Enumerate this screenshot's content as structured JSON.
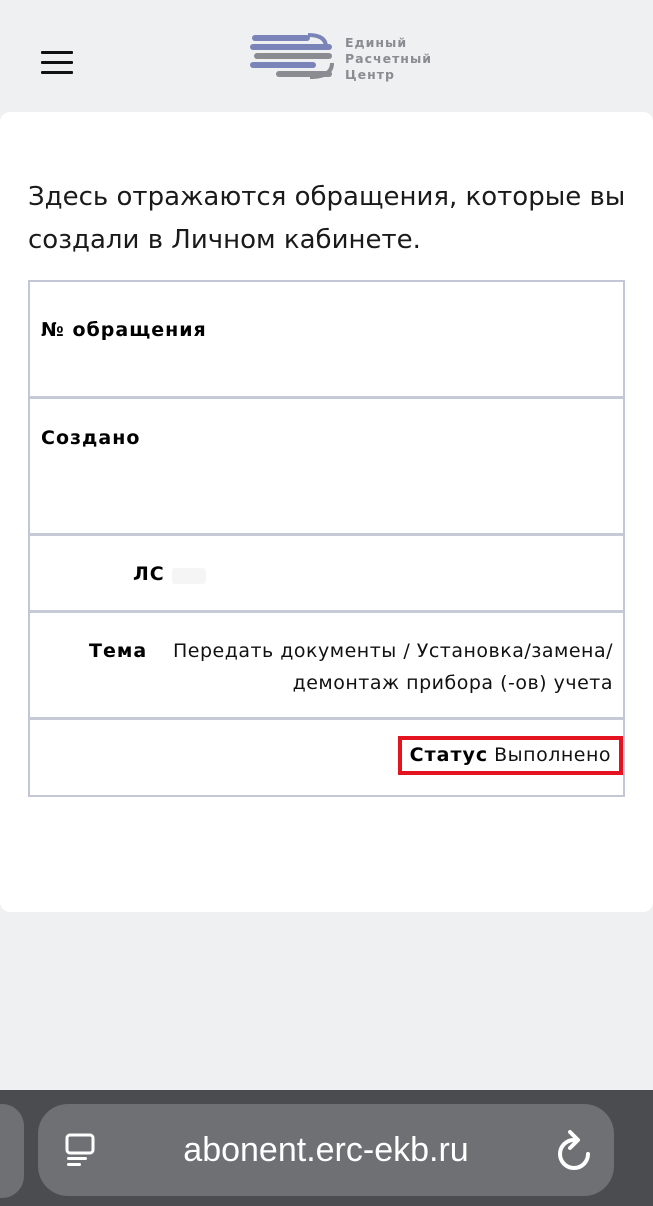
{
  "header": {
    "menu_icon": "hamburger-menu-icon",
    "logo": {
      "line1": "Единый",
      "line2": "Расчетный",
      "line3": "Центр",
      "color": "#8b8c92",
      "stripe_color": "#7a84b8"
    }
  },
  "main": {
    "intro": "Здесь отражаются обращения, которые вы создали в Личном кабинете.",
    "table": {
      "number_label": "№ обращения",
      "created_label": "Создано",
      "account_label": "ЛС",
      "theme_label": "Тема",
      "theme_value": "Передать документы / Установка/замена/ демонтаж прибора (-ов) учета",
      "status_label": "Статус",
      "status_value": "Выполнено"
    },
    "highlight_color": "#e3141f"
  },
  "browser": {
    "url": "abonent.erc-ekb.ru",
    "reader_icon": "reader-mode-icon",
    "reload_icon": "reload-icon"
  }
}
